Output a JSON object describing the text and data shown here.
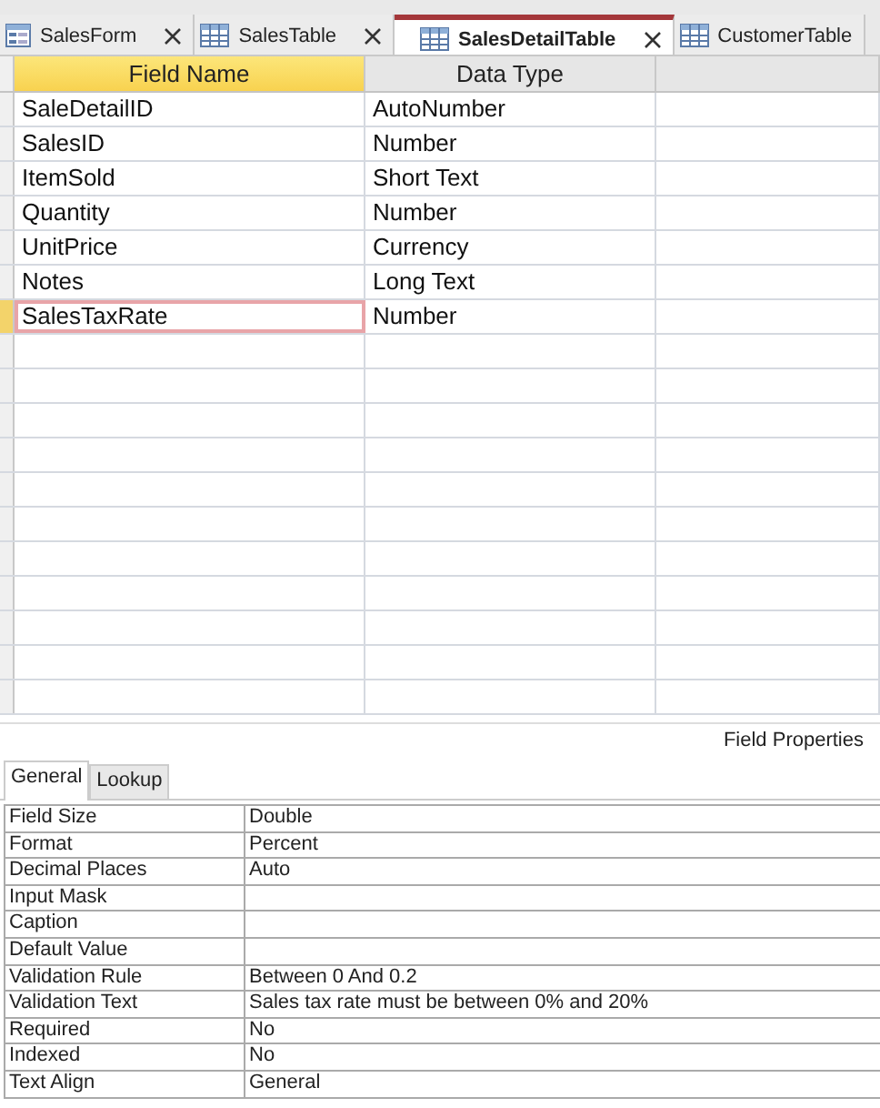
{
  "document_tabs": [
    {
      "label": "SalesForm",
      "kind": "form",
      "selected": false,
      "closable": true
    },
    {
      "label": "SalesTable",
      "kind": "table",
      "selected": false,
      "closable": true
    },
    {
      "label": "SalesDetailTable",
      "kind": "table",
      "selected": true,
      "closable": true
    },
    {
      "label": "CustomerTable",
      "kind": "table",
      "selected": false,
      "closable": false
    }
  ],
  "field_grid": {
    "columns": [
      {
        "label": "Field Name",
        "selected": true
      },
      {
        "label": "Data Type",
        "selected": false
      }
    ],
    "rows": [
      {
        "field_name": "SaleDetailID",
        "data_type": "AutoNumber",
        "selected": false
      },
      {
        "field_name": "SalesID",
        "data_type": "Number",
        "selected": false
      },
      {
        "field_name": "ItemSold",
        "data_type": "Short Text",
        "selected": false
      },
      {
        "field_name": "Quantity",
        "data_type": "Number",
        "selected": false
      },
      {
        "field_name": "UnitPrice",
        "data_type": "Currency",
        "selected": false
      },
      {
        "field_name": "Notes",
        "data_type": "Long Text",
        "selected": false
      },
      {
        "field_name": "SalesTaxRate",
        "data_type": "Number",
        "selected": true
      }
    ]
  },
  "field_properties": {
    "title": "Field Properties",
    "tabs": [
      {
        "label": "General",
        "selected": true
      },
      {
        "label": "Lookup",
        "selected": false
      }
    ],
    "properties": [
      {
        "name": "Field Size",
        "value": "Double"
      },
      {
        "name": "Format",
        "value": "Percent"
      },
      {
        "name": "Decimal Places",
        "value": "Auto"
      },
      {
        "name": "Input Mask"
      },
      {
        "name": "Caption"
      },
      {
        "name": "Default Value"
      },
      {
        "name": "Validation Rule",
        "value": "Between 0 And 0.2"
      },
      {
        "name": "Validation Text",
        "value": "Sales tax rate must be between 0% and 20%"
      },
      {
        "name": "Required",
        "value": "No"
      },
      {
        "name": "Indexed",
        "value": "No"
      },
      {
        "name": "Text Align",
        "value": "General"
      }
    ]
  }
}
